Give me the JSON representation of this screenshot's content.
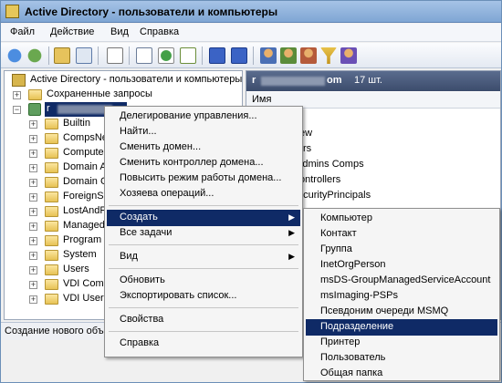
{
  "window": {
    "title": "Active Directory - пользователи и компьютеры"
  },
  "menubar": [
    "Файл",
    "Действие",
    "Вид",
    "Справка"
  ],
  "toolbar": {
    "icons": [
      "back-icon",
      "forward-icon",
      "up-icon",
      "show-tree-icon",
      "copy-icon",
      "properties-icon",
      "refresh-icon",
      "export-icon",
      "help-icon",
      "help-context-icon",
      "users-icon",
      "new-user-icon",
      "new-group-icon",
      "filter-icon",
      "add-to-group-icon"
    ]
  },
  "tree": {
    "root": "Active Directory - пользователи и компьютеры",
    "saved": "Сохраненные запросы",
    "domain": "r",
    "children": [
      "Builtin",
      "CompsNe",
      "Computer",
      "Domain A",
      "Domain C",
      "ForeignSe",
      "LostAndF",
      "Managed",
      "Program D",
      "System",
      "Users",
      "VDI Comp",
      "VDI Users"
    ]
  },
  "right": {
    "domain": "r",
    "domain_tail": "om",
    "count": "17 шт.",
    "column": "Имя",
    "items": [
      "ew",
      "rs",
      "Admins Comps",
      "ontrollers",
      "ecurityPrincipals"
    ]
  },
  "context_menu": {
    "items": [
      "Делегирование управления...",
      "Найти...",
      "Сменить домен...",
      "Сменить контроллер домена...",
      "Повысить режим работы домена...",
      "Хозяева операций...",
      "Создать",
      "Все задачи",
      "Вид",
      "Обновить",
      "Экспортировать список...",
      "Свойства",
      "Справка"
    ]
  },
  "submenu": {
    "items": [
      "Компьютер",
      "Контакт",
      "Группа",
      "InetOrgPerson",
      "msDS-GroupManagedServiceAccount",
      "msImaging-PSPs",
      "Псевдоним очереди MSMQ",
      "Подразделение",
      "Принтер",
      "Пользователь",
      "Общая папка"
    ]
  },
  "status": {
    "text": "Создание нового объ"
  },
  "colors": {
    "highlight": "#0f2a66",
    "title": "#7fa6d4"
  }
}
